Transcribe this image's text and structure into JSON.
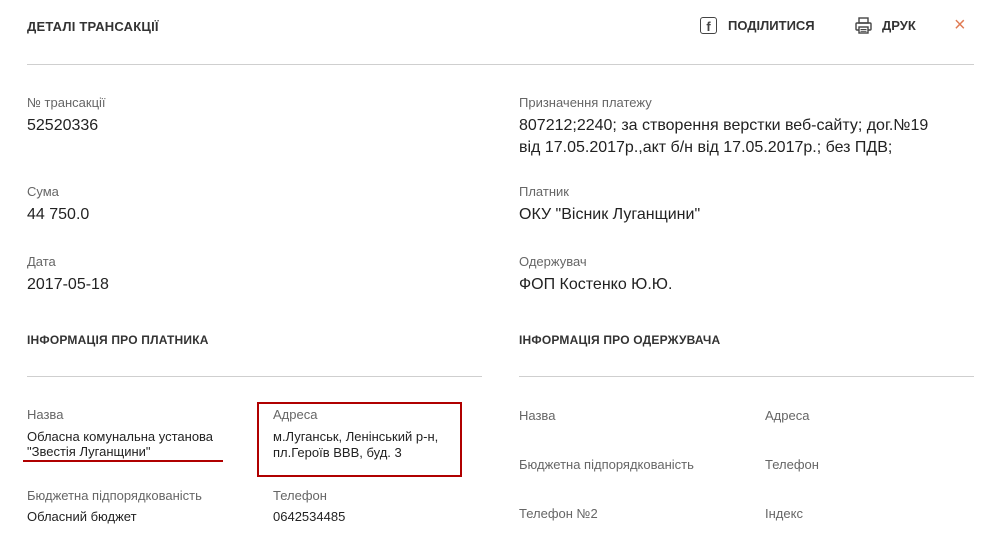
{
  "header": {
    "title": "ДЕТАЛІ ТРАНСАКЦІЇ",
    "share_label": "ПОДІЛИТИСЯ",
    "print_label": "ДРУК",
    "close_symbol": "×",
    "share_icon": "facebook-icon",
    "print_icon": "printer-icon"
  },
  "transaction": {
    "id_label": "№ трансакції",
    "id_value": "52520336",
    "sum_label": "Сума",
    "sum_value": "44 750.0",
    "date_label": "Дата",
    "date_value": "2017-05-18",
    "purpose_label": "Призначення платежу",
    "purpose_line1": "807212;2240; за створення верстки веб-сайту; дог.№19",
    "purpose_line2": "від 17.05.2017р.,акт б/н від 17.05.2017р.; без ПДВ;",
    "payer_label": "Платник",
    "payer_value": "ОКУ \"Вісник Луганщини\"",
    "recipient_label": "Одержувач",
    "recipient_value": "ФОП Костенко Ю.Ю."
  },
  "payer_info": {
    "section_title": "ІНФОРМАЦІЯ ПРО ПЛАТНИКА",
    "name_label": "Назва",
    "name_line1": "Обласна комунальна установа",
    "name_line2": "\"Звестія Луганщини\"",
    "address_label": "Адреса",
    "address_line1": "м.Луганськ, Ленінський р-н,",
    "address_line2": "пл.Героїв ВВВ, буд. 3",
    "budget_label": "Бюджетна підпорядкованість",
    "budget_value": "Обласний бюджет",
    "phone_label": "Телефон",
    "phone_value": "0642534485"
  },
  "recipient_info": {
    "section_title": "ІНФОРМАЦІЯ ПРО ОДЕРЖУВАЧА",
    "name_label": "Назва",
    "address_label": "Адреса",
    "budget_label": "Бюджетна підпорядкованість",
    "phone_label": "Телефон",
    "phone2_label": "Телефон №2",
    "index_label": "Індекс"
  },
  "colors": {
    "accent_close": "#e07b54",
    "annotation_red": "#b00000"
  }
}
